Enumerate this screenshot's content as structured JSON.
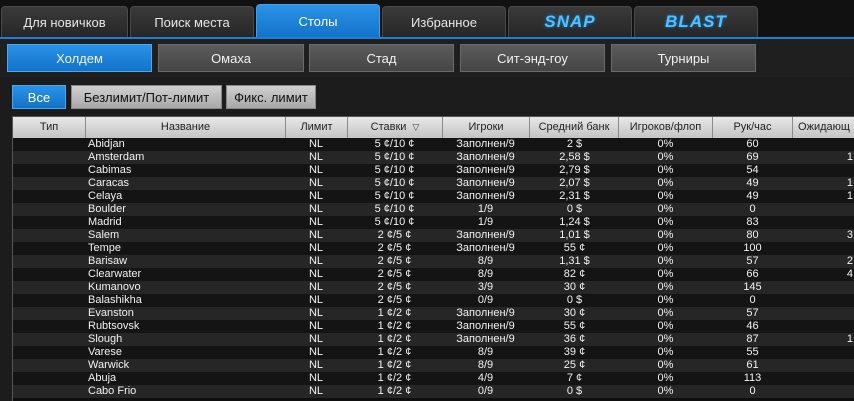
{
  "top_tabs": [
    {
      "label": "Для новичков"
    },
    {
      "label": "Поиск места"
    },
    {
      "label": "Столы"
    },
    {
      "label": "Избранное"
    },
    {
      "label": "SNAP"
    },
    {
      "label": "BLAST"
    }
  ],
  "game_tabs": [
    {
      "label": "Холдем"
    },
    {
      "label": "Омаха"
    },
    {
      "label": "Стад"
    },
    {
      "label": "Сит-энд-гоу"
    },
    {
      "label": "Турниры"
    }
  ],
  "limit_filters": [
    {
      "label": "Все"
    },
    {
      "label": "Безлимит/Пот-лимит"
    },
    {
      "label": "Фикс. лимит"
    }
  ],
  "columns": {
    "type": "Тип",
    "name": "Название",
    "limit": "Лимит",
    "stakes": "Ставки",
    "players": "Игроки",
    "avg_pot": "Средний банк",
    "players_flop": "Игроков/флоп",
    "hands_hour": "Рук/час",
    "waiting": "Ожидающ"
  },
  "rows": [
    {
      "name": "Abidjan",
      "limit": "NL",
      "stakes": "5 ¢/10 ¢",
      "players": "Заполнен/9",
      "pot": "2 $",
      "flop": "0%",
      "hands": "60",
      "wait": ""
    },
    {
      "name": "Amsterdam",
      "limit": "NL",
      "stakes": "5 ¢/10 ¢",
      "players": "Заполнен/9",
      "pot": "2,58 $",
      "flop": "0%",
      "hands": "69",
      "wait": "1"
    },
    {
      "name": "Cabimas",
      "limit": "NL",
      "stakes": "5 ¢/10 ¢",
      "players": "Заполнен/9",
      "pot": "2,79 $",
      "flop": "0%",
      "hands": "54",
      "wait": ""
    },
    {
      "name": "Caracas",
      "limit": "NL",
      "stakes": "5 ¢/10 ¢",
      "players": "Заполнен/9",
      "pot": "2,07 $",
      "flop": "0%",
      "hands": "49",
      "wait": "1"
    },
    {
      "name": "Celaya",
      "limit": "NL",
      "stakes": "5 ¢/10 ¢",
      "players": "Заполнен/9",
      "pot": "2,31 $",
      "flop": "0%",
      "hands": "49",
      "wait": "1"
    },
    {
      "name": "Boulder",
      "limit": "NL",
      "stakes": "5 ¢/10 ¢",
      "players": "1/9",
      "pot": "0 $",
      "flop": "0%",
      "hands": "0",
      "wait": ""
    },
    {
      "name": "Madrid",
      "limit": "NL",
      "stakes": "5 ¢/10 ¢",
      "players": "1/9",
      "pot": "1,24 $",
      "flop": "0%",
      "hands": "83",
      "wait": ""
    },
    {
      "name": "Salem",
      "limit": "NL",
      "stakes": "2 ¢/5 ¢",
      "players": "Заполнен/9",
      "pot": "1,01 $",
      "flop": "0%",
      "hands": "80",
      "wait": "3"
    },
    {
      "name": "Tempe",
      "limit": "NL",
      "stakes": "2 ¢/5 ¢",
      "players": "Заполнен/9",
      "pot": "55 ¢",
      "flop": "0%",
      "hands": "100",
      "wait": ""
    },
    {
      "name": "Barisaw",
      "limit": "NL",
      "stakes": "2 ¢/5 ¢",
      "players": "8/9",
      "pot": "1,31 $",
      "flop": "0%",
      "hands": "57",
      "wait": "2"
    },
    {
      "name": "Clearwater",
      "limit": "NL",
      "stakes": "2 ¢/5 ¢",
      "players": "8/9",
      "pot": "82 ¢",
      "flop": "0%",
      "hands": "66",
      "wait": "4"
    },
    {
      "name": "Kumanovo",
      "limit": "NL",
      "stakes": "2 ¢/5 ¢",
      "players": "3/9",
      "pot": "30 ¢",
      "flop": "0%",
      "hands": "145",
      "wait": ""
    },
    {
      "name": "Balashikha",
      "limit": "NL",
      "stakes": "2 ¢/5 ¢",
      "players": "0/9",
      "pot": "0 $",
      "flop": "0%",
      "hands": "0",
      "wait": ""
    },
    {
      "name": "Evanston",
      "limit": "NL",
      "stakes": "1 ¢/2 ¢",
      "players": "Заполнен/9",
      "pot": "30 ¢",
      "flop": "0%",
      "hands": "57",
      "wait": ""
    },
    {
      "name": "Rubtsovsk",
      "limit": "NL",
      "stakes": "1 ¢/2 ¢",
      "players": "Заполнен/9",
      "pot": "55 ¢",
      "flop": "0%",
      "hands": "46",
      "wait": ""
    },
    {
      "name": "Slough",
      "limit": "NL",
      "stakes": "1 ¢/2 ¢",
      "players": "Заполнен/9",
      "pot": "36 ¢",
      "flop": "0%",
      "hands": "87",
      "wait": "1"
    },
    {
      "name": "Varese",
      "limit": "NL",
      "stakes": "1 ¢/2 ¢",
      "players": "8/9",
      "pot": "39 ¢",
      "flop": "0%",
      "hands": "55",
      "wait": ""
    },
    {
      "name": "Warwick",
      "limit": "NL",
      "stakes": "1 ¢/2 ¢",
      "players": "8/9",
      "pot": "25 ¢",
      "flop": "0%",
      "hands": "61",
      "wait": ""
    },
    {
      "name": "Abuja",
      "limit": "NL",
      "stakes": "1 ¢/2 ¢",
      "players": "4/9",
      "pot": "7 ¢",
      "flop": "0%",
      "hands": "113",
      "wait": ""
    },
    {
      "name": "Cabo Frio",
      "limit": "NL",
      "stakes": "1 ¢/2 ¢",
      "players": "0/9",
      "pot": "0 $",
      "flop": "0%",
      "hands": "0",
      "wait": ""
    }
  ]
}
